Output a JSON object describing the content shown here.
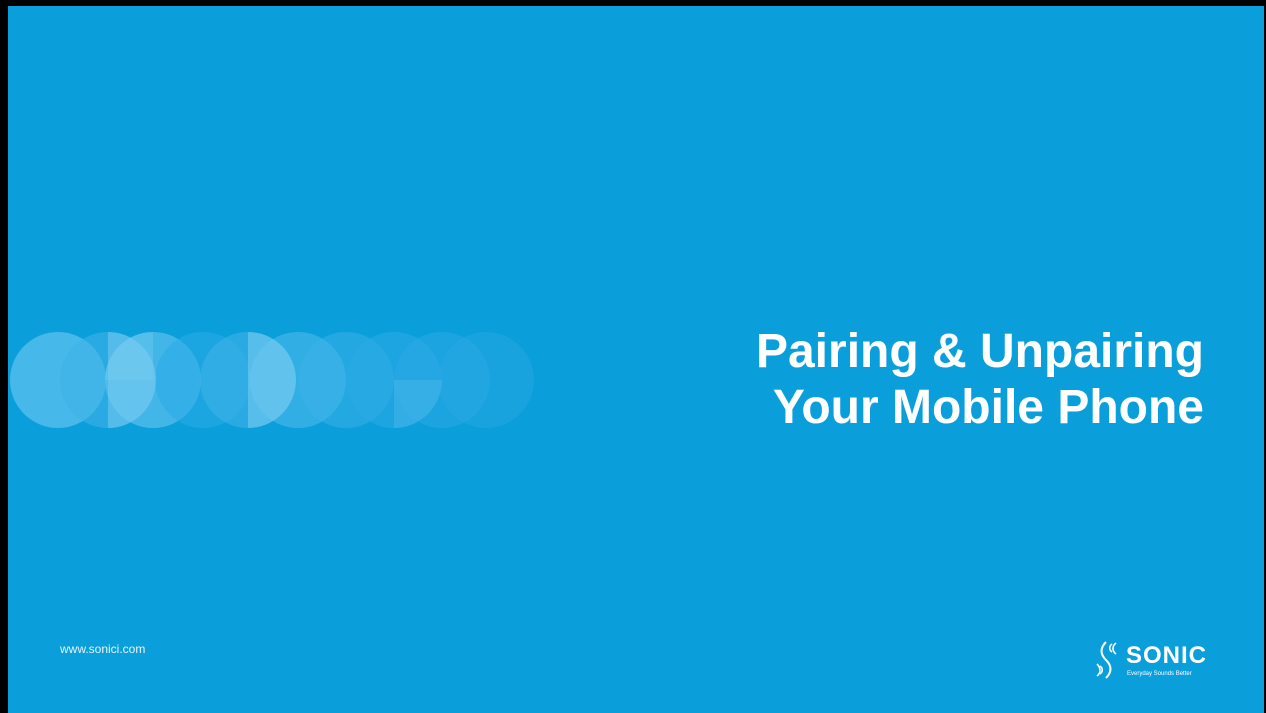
{
  "slide": {
    "title_line_1": "Pairing & Unpairing",
    "title_line_2": "Your Mobile Phone",
    "website": "www.sonici.com",
    "background_color": "#0a9fdb",
    "text_color": "#ffffff"
  },
  "logo": {
    "name": "SONIC",
    "tagline": "Everyday Sounds Better",
    "icon": "sound-waves-icon"
  },
  "decoration": {
    "icon": "circle-pattern"
  }
}
